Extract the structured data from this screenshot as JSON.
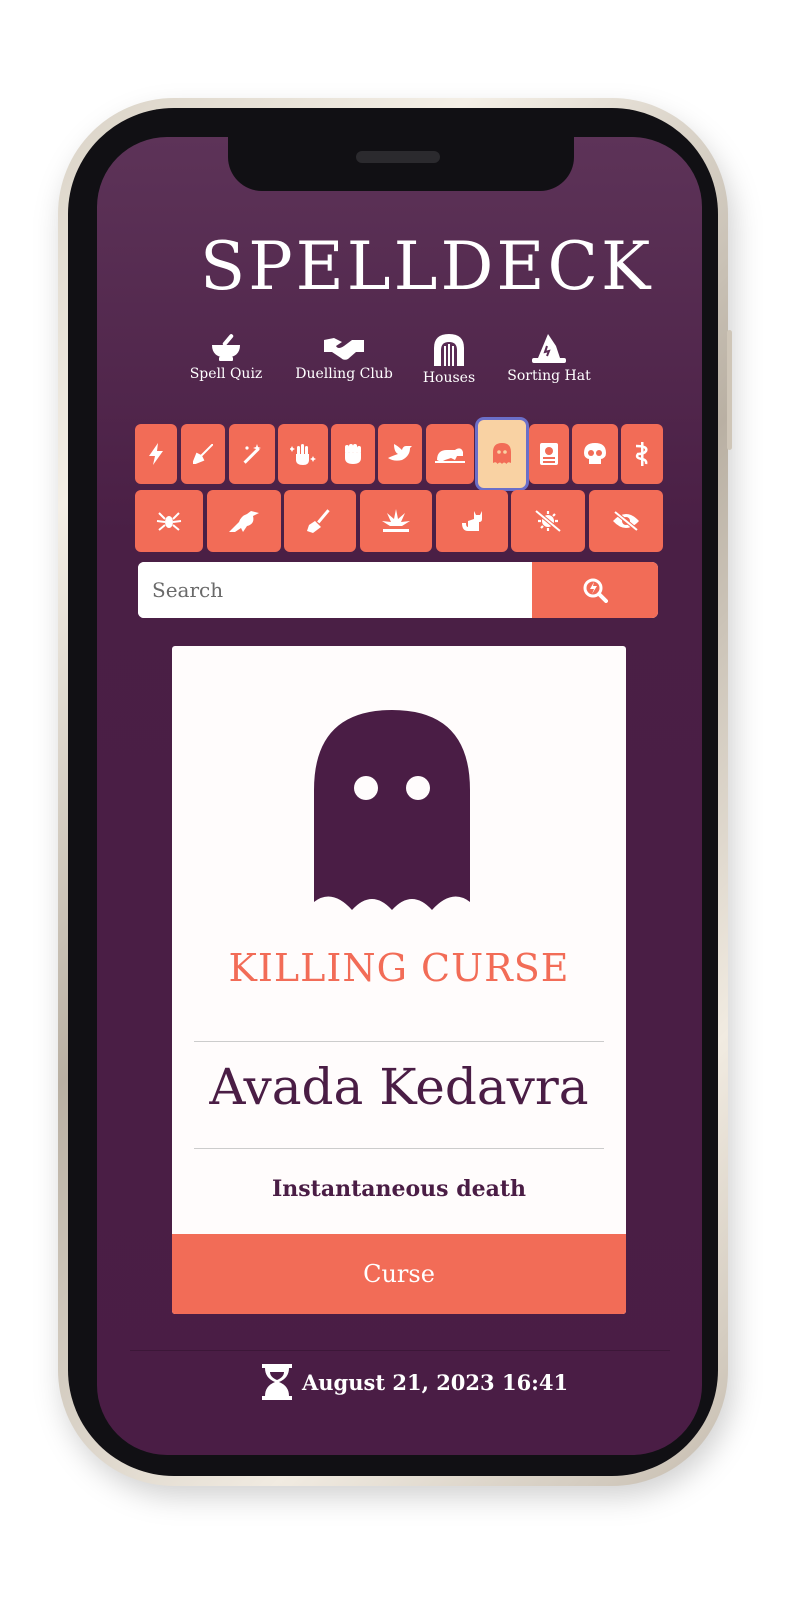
{
  "app": {
    "title": "SPELLDECK"
  },
  "nav": [
    {
      "label": "Spell Quiz",
      "icon": "mortar-pestle-icon"
    },
    {
      "label": "Duelling Club",
      "icon": "handshake-icon"
    },
    {
      "label": "Houses",
      "icon": "dungeon-icon"
    },
    {
      "label": "Sorting Hat",
      "icon": "hat-wizard-icon"
    }
  ],
  "categories": {
    "row1": [
      "bolt-icon",
      "pen-nib-icon",
      "magic-wand-icon",
      "hand-sparkles-icon",
      "fist-icon",
      "dove-icon",
      "hippo-icon",
      "ghost-icon",
      "book-dead-icon",
      "skull-icon",
      "staff-snake-icon"
    ],
    "row2": [
      "spider-icon",
      "crow-icon",
      "broom-icon",
      "explosion-icon",
      "cat-icon",
      "disease-slash-icon",
      "eye-slash-icon"
    ],
    "active": "ghost-icon"
  },
  "search": {
    "placeholder": "Search",
    "button_icon": "magnifying-glass-bolt-icon"
  },
  "card": {
    "icon": "ghost-icon",
    "category": "KILLING CURSE",
    "incantation": "Avada Kedavra",
    "effect": "Instantaneous death",
    "type": "Curse"
  },
  "footer": {
    "timestamp": "August 21, 2023 16:41",
    "icon": "hourglass-icon"
  },
  "colors": {
    "background": "#4a1d45",
    "accent": "#f26c57",
    "active_tile": "#f9d2a3",
    "card": "#fffcfc"
  }
}
